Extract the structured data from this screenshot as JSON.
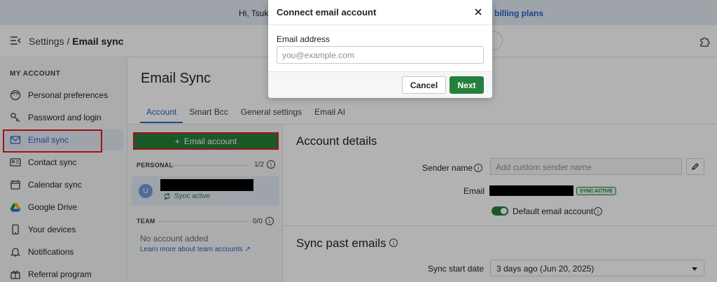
{
  "banner": {
    "greeting": "Hi, Tsuki",
    "link": "billing plans"
  },
  "breadcrumb": {
    "parent": "Settings",
    "separator": "/",
    "current": "Email sync"
  },
  "sidebar": {
    "section": "MY ACCOUNT",
    "items": [
      {
        "label": "Personal preferences",
        "icon": "face-icon"
      },
      {
        "label": "Password and login",
        "icon": "key-icon"
      },
      {
        "label": "Email sync",
        "icon": "envelope-icon",
        "active": true
      },
      {
        "label": "Contact sync",
        "icon": "contact-card-icon"
      },
      {
        "label": "Calendar sync",
        "icon": "calendar-icon"
      },
      {
        "label": "Google Drive",
        "icon": "google-drive-icon"
      },
      {
        "label": "Your devices",
        "icon": "phone-icon"
      },
      {
        "label": "Notifications",
        "icon": "bell-icon"
      },
      {
        "label": "Referral program",
        "icon": "gift-icon"
      }
    ]
  },
  "main": {
    "title": "Email Sync",
    "tabs": [
      {
        "label": "Account",
        "active": true
      },
      {
        "label": "Smart Bcc"
      },
      {
        "label": "General settings"
      },
      {
        "label": "Email AI"
      }
    ]
  },
  "accounts": {
    "add_button": "Email account",
    "personal": {
      "label": "PERSONAL",
      "count": "1/2"
    },
    "card": {
      "avatar": "U",
      "status": "Sync active"
    },
    "team": {
      "label": "TEAM",
      "count": "0/0",
      "empty": "No account added",
      "link": "Learn more about team accounts ↗"
    }
  },
  "details": {
    "title": "Account details",
    "sender_label": "Sender name",
    "sender_placeholder": "Add custom sender name",
    "email_label": "Email",
    "sync_badge": "SYNC ACTIVE",
    "default_label": "Default email account",
    "default_on": true,
    "past_title": "Sync past emails",
    "start_label": "Sync start date",
    "start_value": "3 days ago (Jun 20, 2025)"
  },
  "modal": {
    "title": "Connect email account",
    "field_label": "Email address",
    "placeholder": "you@example.com",
    "cancel": "Cancel",
    "next": "Next"
  },
  "colors": {
    "accent": "#2d61c7",
    "primary_green": "#25803c",
    "highlight_red": "#e21e1e"
  }
}
